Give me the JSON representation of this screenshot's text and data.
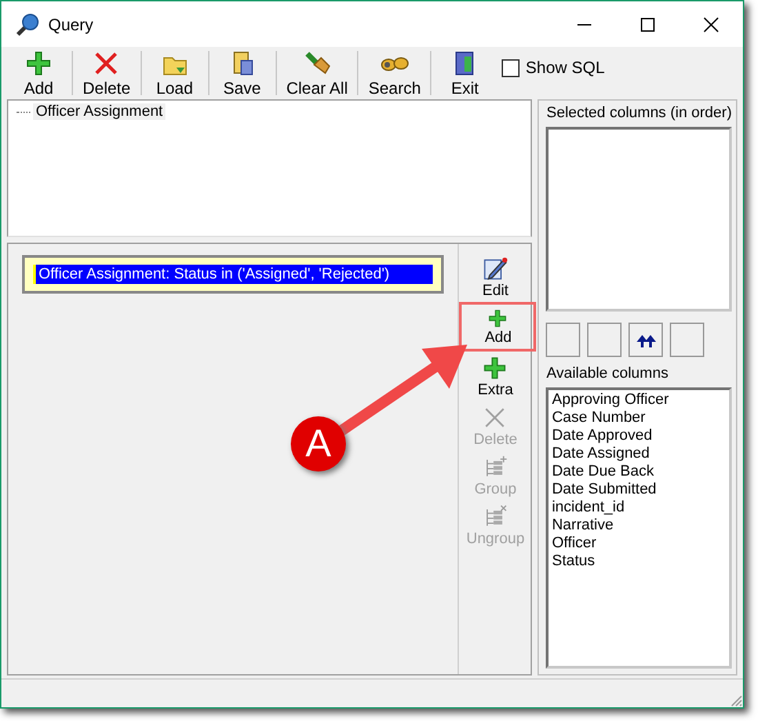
{
  "window": {
    "title": "Query"
  },
  "toolbar": [
    {
      "label": "Add",
      "kind": "add"
    },
    {
      "label": "Delete",
      "kind": "delete"
    },
    {
      "label": "Load",
      "kind": "load"
    },
    {
      "label": "Save",
      "kind": "save"
    },
    {
      "label": "Clear All",
      "kind": "clear"
    },
    {
      "label": "Search",
      "kind": "search"
    },
    {
      "label": "Exit",
      "kind": "exit"
    }
  ],
  "show_sql": {
    "label": "Show SQL",
    "checked": false
  },
  "tree": {
    "items": [
      "Officer Assignment"
    ]
  },
  "conditions": [
    {
      "text": "Officer Assignment: Status in ('Assigned', 'Rejected')",
      "selected": true
    }
  ],
  "side_buttons": [
    {
      "label": "Edit",
      "kind": "edit",
      "disabled": false
    },
    {
      "label": "Add",
      "kind": "add",
      "disabled": false,
      "highlighted": true
    },
    {
      "label": "Extra",
      "kind": "add",
      "disabled": false
    },
    {
      "label": "Delete",
      "kind": "delete",
      "disabled": true
    },
    {
      "label": "Group",
      "kind": "group",
      "disabled": true
    },
    {
      "label": "Ungroup",
      "kind": "ungroup",
      "disabled": true
    }
  ],
  "selected_columns": {
    "label": "Selected columns (in order)"
  },
  "column_buttons": [
    {
      "kind": "blank"
    },
    {
      "kind": "blank"
    },
    {
      "kind": "top"
    },
    {
      "kind": "blank"
    }
  ],
  "available_columns": {
    "label": "Available columns",
    "items": [
      "Approving Officer",
      "Case Number",
      "Date Approved",
      "Date Assigned",
      "Date Due Back",
      "Date Submitted",
      "incident_id",
      "Narrative",
      "Officer",
      "Status"
    ]
  },
  "annotation": {
    "label": "A"
  }
}
